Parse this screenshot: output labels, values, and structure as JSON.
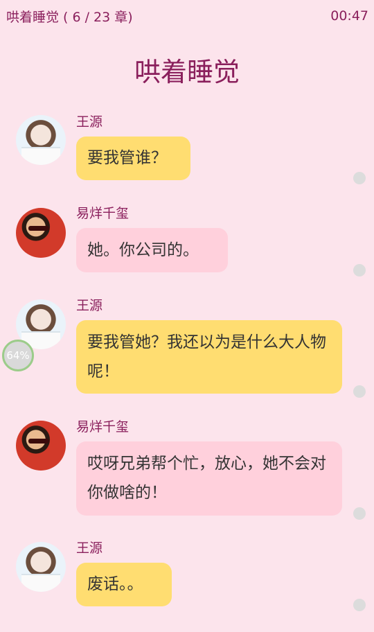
{
  "status_bar": {
    "chapter": "哄着睡觉 ( 6 / 23 章)",
    "time": "00:47"
  },
  "page_title": "哄着睡觉",
  "messages": [
    {
      "sender": "王源",
      "text": "要我管谁？",
      "bubble_color": "#ffdd71"
    },
    {
      "sender": "易烊千玺",
      "text": "她。你公司的。",
      "bubble_color": "#ffd0dc"
    },
    {
      "sender": "王源",
      "text": "要我管她？我还以为是什么大人物呢！",
      "bubble_color": "#ffdd71"
    },
    {
      "sender": "易烊千玺",
      "text": "哎呀兄弟帮个忙，放心，她不会对你做啥的！",
      "bubble_color": "#ffd0dc"
    },
    {
      "sender": "王源",
      "text": "废话。。",
      "bubble_color": "#ffdd71"
    }
  ],
  "reading_progress": "64%",
  "colors": {
    "background": "#fce4ec",
    "accent": "#8a1f5c"
  }
}
